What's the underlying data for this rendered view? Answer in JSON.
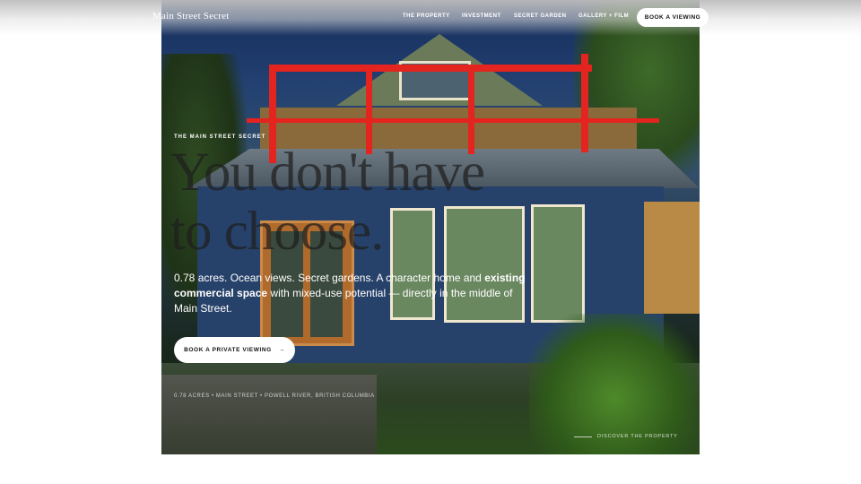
{
  "header": {
    "brand": "Main Street Secret",
    "nav": [
      "THE PROPERTY",
      "INVESTMENT",
      "SECRET GARDEN",
      "GALLERY + FILM"
    ],
    "cta": "BOOK A VIEWING"
  },
  "hero": {
    "eyebrow": "THE MAIN STREET SECRET",
    "headline": "You don't have\nto choose.",
    "lead_parts": [
      "0.78 acres. Ocean views. Secret gardens. A character home and ",
      "existing commercial space",
      " with mixed-use potential — directly in the middle of Main Street."
    ],
    "cta": "BOOK A PRIVATE VIEWING",
    "cta_arrow": "→",
    "meta": "0.78 ACRES • MAIN STREET • POWELL RIVER, BRITISH COLUMBIA",
    "discover": "DISCOVER THE PROPERTY"
  },
  "colors": {
    "rail": "#e3241f",
    "button_bg": "#ffffff",
    "button_text": "#111111"
  },
  "icons": {
    "cta_arrow": "arrow-right-icon"
  }
}
